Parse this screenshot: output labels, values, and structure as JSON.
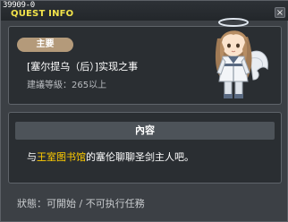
{
  "window": {
    "quest_id": "39909-0",
    "title": "QUEST INFO",
    "close_label": "×"
  },
  "quest": {
    "tag": "主要",
    "name": "[塞尔提乌（后）]实现之事",
    "required_level": "建議等級：265以上"
  },
  "content": {
    "header": "內容",
    "text_prefix": "与",
    "text_highlight": "王室图书馆",
    "text_suffix": "的塞伦聊聊圣剑主人吧。"
  },
  "status": {
    "text": "狀態：可開始 / 不可执行任務"
  },
  "colors": {
    "title": "#f2e34a",
    "highlight": "#ffcc00",
    "tag_bg": "#b49a7a",
    "panel_bg": "#2a2e32",
    "window_bg": "#3c4045"
  }
}
